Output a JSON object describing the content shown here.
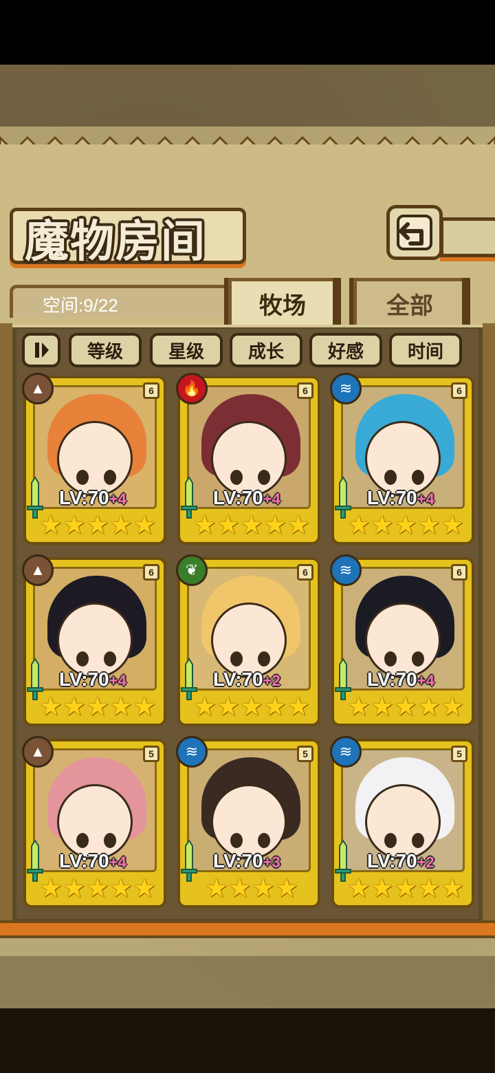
{
  "screen": {
    "title": "魔物房间",
    "space_label": "空间:9/22",
    "tabs": [
      {
        "label": "牧场",
        "active": true
      },
      {
        "label": "全部",
        "active": false
      }
    ],
    "sort_buttons": [
      {
        "label": ""
      },
      {
        "label": "等级"
      },
      {
        "label": "星级"
      },
      {
        "label": "成长"
      },
      {
        "label": "好感"
      },
      {
        "label": "时间"
      }
    ]
  },
  "cards": [
    {
      "element": "earth",
      "grade": "6",
      "lv": "LV:70",
      "plus": "+4",
      "stars": 5,
      "hair": "#e8823a",
      "bg": "#d9b36a",
      "elem_color": "#7a5236"
    },
    {
      "element": "fire",
      "grade": "6",
      "lv": "LV:70",
      "plus": "+4",
      "stars": 5,
      "hair": "#7b2e33",
      "bg": "#caa76a",
      "elem_color": "#c4161c"
    },
    {
      "element": "water",
      "grade": "6",
      "lv": "LV:70",
      "plus": "+4",
      "stars": 5,
      "hair": "#39a9d6",
      "bg": "#c9b07a",
      "elem_color": "#1e73b9"
    },
    {
      "element": "earth",
      "grade": "6",
      "lv": "LV:70",
      "plus": "+4",
      "stars": 5,
      "hair": "#1e1a24",
      "bg": "#d3ae64",
      "elem_color": "#7a5236"
    },
    {
      "element": "wood",
      "grade": "6",
      "lv": "LV:70",
      "plus": "+2",
      "stars": 5,
      "hair": "#f1c56a",
      "bg": "#d7b874",
      "elem_color": "#3a7d2a"
    },
    {
      "element": "water",
      "grade": "6",
      "lv": "LV:70",
      "plus": "+4",
      "stars": 5,
      "hair": "#1b1b24",
      "bg": "#cbb07a",
      "elem_color": "#1e73b9"
    },
    {
      "element": "earth",
      "grade": "5",
      "lv": "LV:70",
      "plus": "+4",
      "stars": 5,
      "hair": "#e4949b",
      "bg": "#d6b272",
      "elem_color": "#7a5236"
    },
    {
      "element": "water",
      "grade": "5",
      "lv": "LV:70",
      "plus": "+3",
      "stars": 4,
      "hair": "#3a2a22",
      "bg": "#c9ad72",
      "elem_color": "#1e73b9"
    },
    {
      "element": "water",
      "grade": "5",
      "lv": "LV:70",
      "plus": "+2",
      "stars": 5,
      "hair": "#f2f2f4",
      "bg": "#c9b48a",
      "elem_color": "#1e73b9"
    }
  ],
  "icons": {
    "back": "back-arrow-icon",
    "toggle": "sort-toggle-icon",
    "earth": "mountain-icon",
    "fire": "flame-icon",
    "water": "wave-icon",
    "wood": "leaf-icon",
    "sword": "sword-icon",
    "star": "star-icon"
  }
}
